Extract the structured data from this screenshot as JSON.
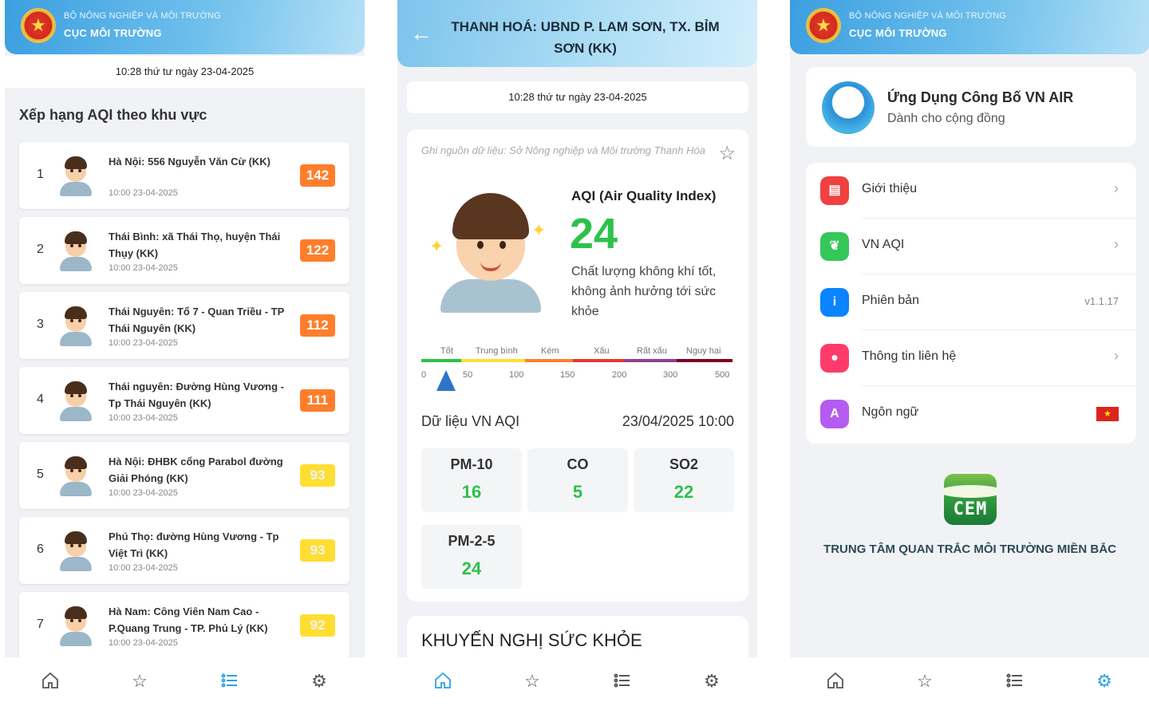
{
  "screen1": {
    "header": {
      "ministry": "BỘ NÔNG NGHIỆP VÀ MÔI TRƯỜNG",
      "agency": "CỤC MÔI TRƯỜNG"
    },
    "datetime": "10:28 thứ tư ngày 23-04-2025",
    "section_title": "Xếp hạng AQI theo khu vực",
    "rankings": [
      {
        "rank": "1",
        "location": "Hà Nội: 556 Nguyễn Văn Cừ (KK)",
        "time": "10:00 23-04-2025",
        "aqi": "142",
        "color": "#ff7e2b"
      },
      {
        "rank": "2",
        "location": "Thái Bình: xã Thái Thọ, huyện Thái Thụy (KK)",
        "time": "10:00 23-04-2025",
        "aqi": "122",
        "color": "#ff7e2b"
      },
      {
        "rank": "3",
        "location": "Thái Nguyên: Tổ 7 - Quan Triều - TP Thái Nguyên (KK)",
        "time": "10:00 23-04-2025",
        "aqi": "112",
        "color": "#ff7e2b"
      },
      {
        "rank": "4",
        "location": "Thái nguyên: Đường Hùng Vương - Tp Thái Nguyên (KK)",
        "time": "10:00 23-04-2025",
        "aqi": "111",
        "color": "#ff7e2b"
      },
      {
        "rank": "5",
        "location": "Hà Nội: ĐHBK cổng Parabol đường Giải Phóng (KK)",
        "time": "10:00 23-04-2025",
        "aqi": "93",
        "color": "#ffde33"
      },
      {
        "rank": "6",
        "location": "Phú Thọ: đường Hùng Vương - Tp Việt Trì (KK)",
        "time": "10:00 23-04-2025",
        "aqi": "93",
        "color": "#ffde33"
      },
      {
        "rank": "7",
        "location": "Hà Nam: Công Viên Nam Cao - P.Quang Trung - TP. Phủ Lý (KK)",
        "time": "10:00 23-04-2025",
        "aqi": "92",
        "color": "#ffde33"
      }
    ]
  },
  "screen2": {
    "title": "THANH HOÁ: UBND P. LAM SƠN, TX. BỈM SƠN (KK)",
    "datetime": "10:28 thứ tư ngày 23-04-2025",
    "source_note": "Ghi nguồn dữ liệu: Sở Nông nghiệp và Môi trường Thanh Hóa",
    "aqi_title": "AQI (Air Quality Index)",
    "aqi_value": "24",
    "aqi_value_color": "#2cc24a",
    "aqi_description": "Chất lượng không khí tốt, không ảnh hưởng tới sức khỏe",
    "scale_categories": [
      "Tốt",
      "Trung bình",
      "Kém",
      "Xấu",
      "Rất xấu",
      "Nguy hại"
    ],
    "scale_colors": [
      "#2cc24a",
      "#ffde33",
      "#ff7e2b",
      "#e53935",
      "#8f3f97",
      "#7e0023"
    ],
    "scale_ticks": [
      "0",
      "50",
      "100",
      "150",
      "200",
      "300",
      "500"
    ],
    "data_label": "Dữ liệu VN AQI",
    "data_timestamp": "23/04/2025 10:00",
    "pollutants": [
      {
        "name": "PM-10",
        "value": "16"
      },
      {
        "name": "CO",
        "value": "5"
      },
      {
        "name": "SO2",
        "value": "22"
      },
      {
        "name": "PM-2-5",
        "value": "24"
      }
    ],
    "health_title": "KHUYẾN NGHỊ SỨC KHỎE"
  },
  "screen3": {
    "header": {
      "ministry": "BỘ NÔNG NGHIỆP VÀ MÔI TRƯỜNG",
      "agency": "CỤC MÔI TRƯỜNG"
    },
    "app_name": "Ứng Dụng Công Bố VN AIR",
    "app_subtitle": "Dành cho cộng đồng",
    "menu": [
      {
        "label": "Giới thiệu",
        "icon": "info-doc-icon",
        "icon_color": "#f04040",
        "trailing": "›"
      },
      {
        "label": "VN AQI",
        "icon": "leaf-icon",
        "icon_color": "#34c759",
        "trailing": "›"
      },
      {
        "label": "Phiên bản",
        "icon": "info-icon",
        "icon_color": "#0a84ff",
        "trailing": "v1.1.17"
      },
      {
        "label": "Thông tin liên hệ",
        "icon": "chat-icon",
        "icon_color": "#ff3b6b",
        "trailing": "›"
      },
      {
        "label": "Ngôn ngữ",
        "icon": "translate-icon",
        "icon_color": "#b45cf0",
        "trailing": "vn-flag"
      }
    ],
    "org_logo_text": "CEM",
    "org_name": "TRUNG TÂM QUAN TRẮC MÔI TRƯỜNG MIỀN BẮC"
  },
  "tabbar": {
    "icons": [
      "home-icon",
      "star-icon",
      "list-icon",
      "settings-icon"
    ],
    "active_color": "#2ea0e6",
    "inactive_color": "#555555"
  }
}
